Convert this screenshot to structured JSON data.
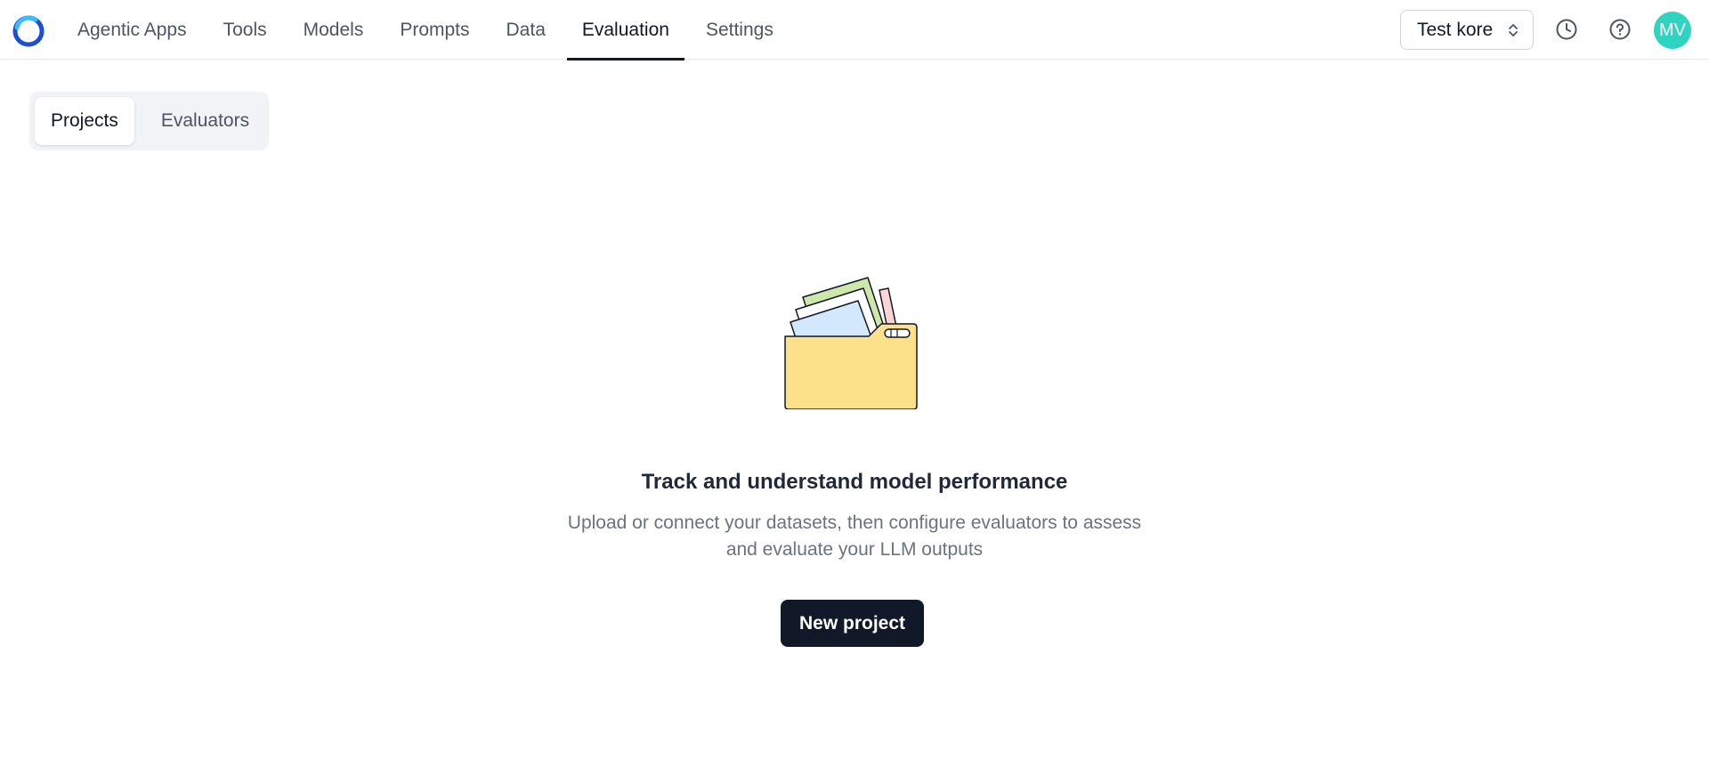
{
  "nav": {
    "items": [
      {
        "label": "Agentic Apps"
      },
      {
        "label": "Tools"
      },
      {
        "label": "Models"
      },
      {
        "label": "Prompts"
      },
      {
        "label": "Data"
      },
      {
        "label": "Evaluation",
        "active": true
      },
      {
        "label": "Settings"
      }
    ]
  },
  "header": {
    "workspace": "Test kore",
    "avatar_initials": "MV",
    "avatar_color": "#2dd4bf",
    "icons": [
      "history-icon",
      "help-icon"
    ]
  },
  "subtabs": [
    {
      "label": "Projects",
      "active": true
    },
    {
      "label": "Evaluators"
    }
  ],
  "empty_state": {
    "title": "Track and understand model performance",
    "description": "Upload or connect your datasets, then configure evaluators to assess and evaluate your LLM outputs",
    "button_label": "New project"
  },
  "colors": {
    "accent": "#111827",
    "brand": "#2563eb",
    "folder": "#fde08a"
  }
}
